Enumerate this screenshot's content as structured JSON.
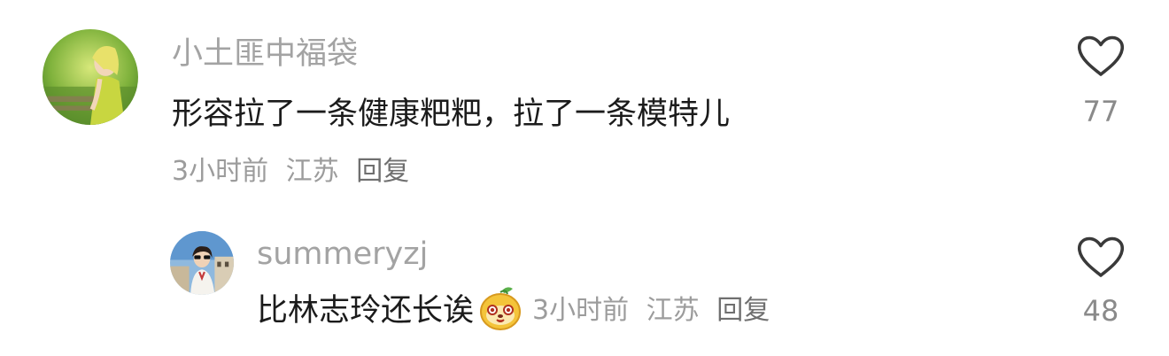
{
  "comments": [
    {
      "username": "小土匪中福袋",
      "text": "形容拉了一条健康粑粑，拉了一条模特儿",
      "time": "3小时前",
      "location": "江苏",
      "reply_label": "回复",
      "like_count": "77",
      "avatar_icon": "avatar-woman-green-dress"
    },
    {
      "username": "summeryzj",
      "text": "比林志玲还长诶",
      "emoji_icon": "orange-fruit-face-emoji",
      "time": "3小时前",
      "location": "江苏",
      "reply_label": "回复",
      "like_count": "48",
      "avatar_icon": "avatar-woman-sunglasses"
    }
  ],
  "colors": {
    "username": "#a3a3a3",
    "text": "#1b1b1b",
    "meta": "#9c9c9c",
    "heart_stroke": "#3a3a3a"
  }
}
